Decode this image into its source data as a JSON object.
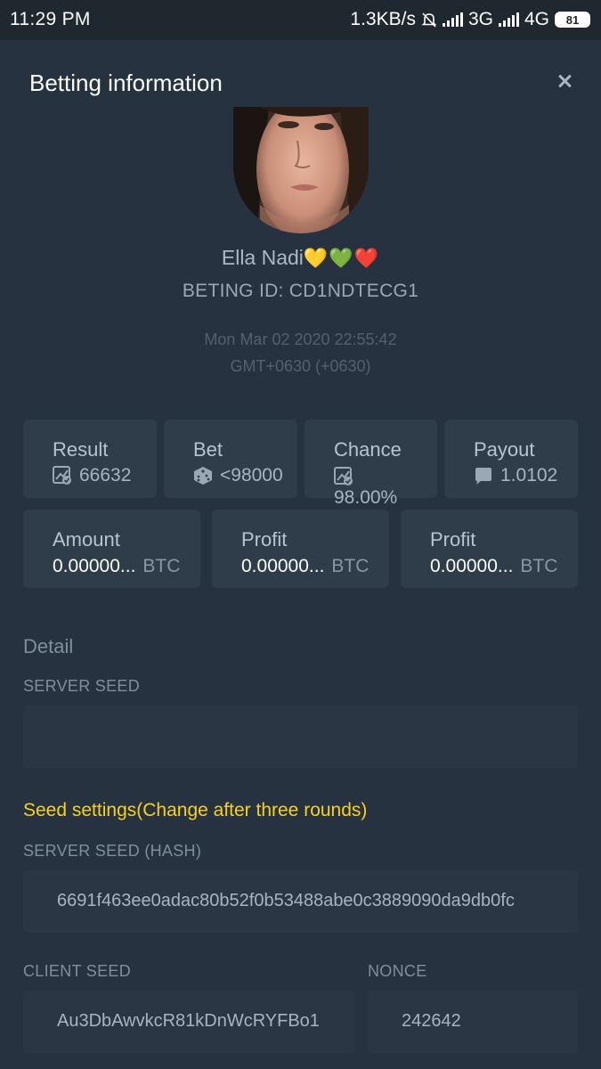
{
  "status_bar": {
    "time": "11:29  PM",
    "speed": "1.3KB/s",
    "network1": "3G",
    "network2": "4G",
    "battery": "81",
    "icons": [
      "mute-bell-icon",
      "signal-icon",
      "signal-icon",
      "battery-icon"
    ]
  },
  "modal": {
    "title": "Betting information",
    "close_icon": "close-icon"
  },
  "user": {
    "name": "Ella Nadi",
    "hearts": "💛💚❤️",
    "bet_id": "BETING ID: CD1NDTECG1",
    "date_line1": "Mon Mar 02 2020 22:55:42",
    "date_line2": "GMT+0630 (+0630)"
  },
  "stats": [
    {
      "label": "Result",
      "value": "66632",
      "icon": "chart-check-icon"
    },
    {
      "label": "Bet",
      "value": "<98000",
      "icon": "dice-icon"
    },
    {
      "label": "Chance",
      "value": "98.00%",
      "icon": "chart-check-icon"
    },
    {
      "label": "Payout",
      "value": "1.0102",
      "icon": "wallet-icon"
    }
  ],
  "money": [
    {
      "label": "Amount",
      "value": "0.00000...",
      "currency": "BTC"
    },
    {
      "label": "Profit",
      "value": "0.00000...",
      "currency": "BTC"
    },
    {
      "label": "Profit",
      "value": "0.00000...",
      "currency": "BTC"
    }
  ],
  "detail": {
    "title": "Detail",
    "server_seed_label": "SERVER SEED",
    "server_seed_value": ""
  },
  "seed_settings": {
    "title": "Seed settings(Change after three rounds)",
    "hash_label": "SERVER SEED (HASH)",
    "hash_value": "6691f463ee0adac80b52f0b53488abe0c3889090da9db0fc",
    "client_seed_label": "CLIENT SEED",
    "client_seed_value": "Au3DbAwvkcR81kDnWcRYFBo1",
    "nonce_label": "NONCE",
    "nonce_value": "242642"
  },
  "colors": {
    "background": "#263240",
    "card": "#2f3c4a",
    "accent_yellow": "#f7d11c"
  }
}
